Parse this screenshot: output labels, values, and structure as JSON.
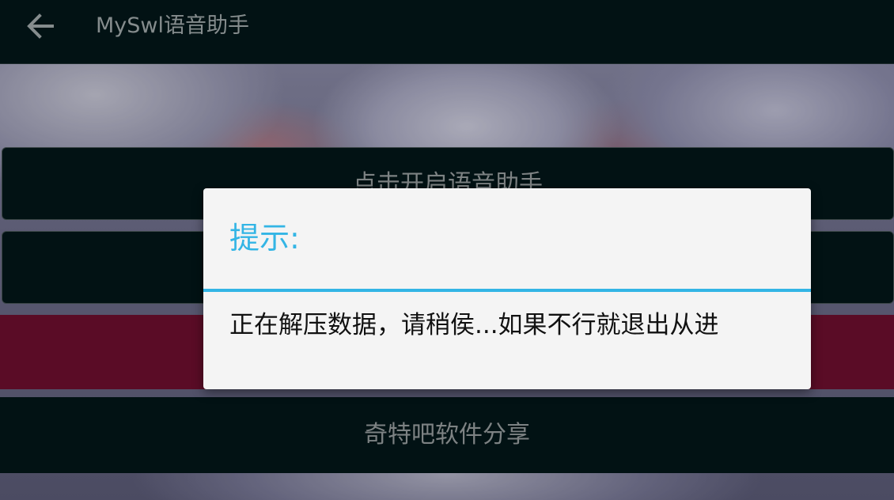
{
  "toolbar": {
    "title": "MySwl语音助手",
    "back_icon": "arrow-left-icon"
  },
  "buttons": {
    "voice_assistant": "点击开启语音助手",
    "second": "",
    "accent": "",
    "share": "奇特吧软件分享"
  },
  "dialog": {
    "title": "提示:",
    "message": "正在解压数据，请稍侯...如果不行就退出从进"
  },
  "colors": {
    "dialog_accent": "#33b5e5",
    "toolbar_bg": "#021214",
    "accent_button_bg": "#5a0c26"
  }
}
